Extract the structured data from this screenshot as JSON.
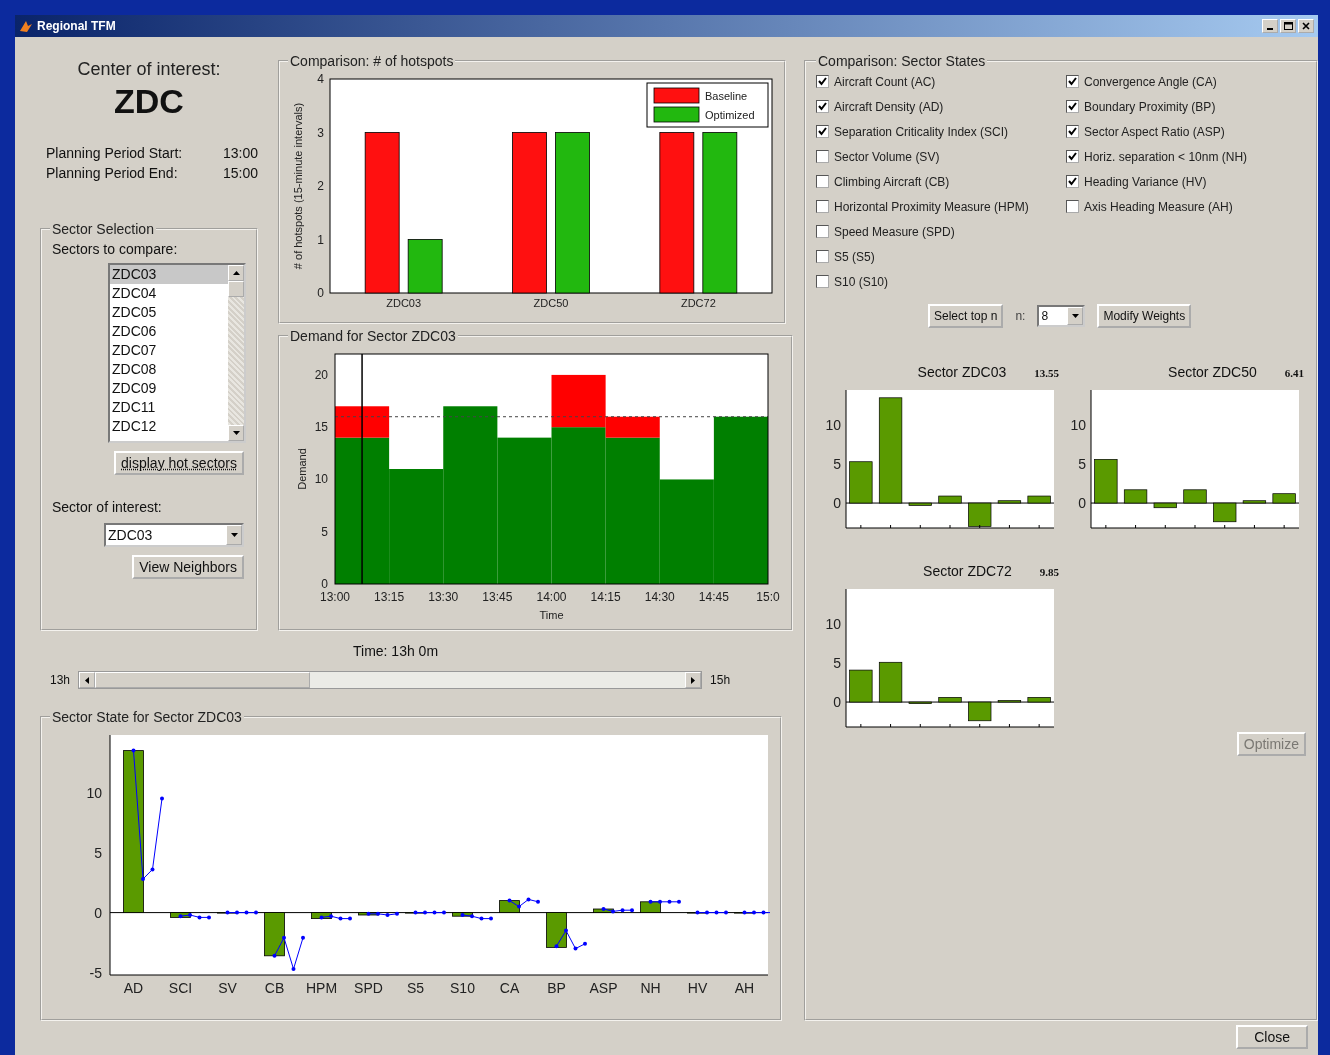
{
  "window": {
    "title": "Regional TFM"
  },
  "center": {
    "label": "Center of interest:",
    "value": "ZDC"
  },
  "planning": [
    {
      "label": "Planning Period Start:",
      "value": "13:00"
    },
    {
      "label": "Planning Period End:",
      "value": "15:00"
    }
  ],
  "sector_selection": {
    "title": "Sector Selection",
    "compare_label": "Sectors to compare:",
    "sectors": [
      {
        "label": "ZDC03",
        "selected": true
      },
      {
        "label": "ZDC04",
        "selected": false
      },
      {
        "label": "ZDC05",
        "selected": false
      },
      {
        "label": "ZDC06",
        "selected": false
      },
      {
        "label": "ZDC07",
        "selected": false
      },
      {
        "label": "ZDC08",
        "selected": false
      },
      {
        "label": "ZDC09",
        "selected": false
      },
      {
        "label": "ZDC11",
        "selected": false
      },
      {
        "label": "ZDC12",
        "selected": false
      }
    ],
    "hot_button": "display hot sectors",
    "interest_label": "Sector of interest:",
    "interest_value": "ZDC03",
    "neighbors_button": "View Neighbors"
  },
  "hotspots": {
    "title": "Comparison: # of hotspots",
    "chart_data": {
      "type": "bar",
      "ylabel": "# of hotspots (15-minute intervals)",
      "categories": [
        "ZDC03",
        "ZDC50",
        "ZDC72"
      ],
      "ylim": [
        0,
        4
      ],
      "yticks": [
        0,
        1,
        2,
        3,
        4
      ],
      "legend": true,
      "series": [
        {
          "name": "Baseline",
          "color": "#ff1010",
          "values": [
            3,
            3,
            3
          ]
        },
        {
          "name": "Optimized",
          "color": "#22b80f",
          "values": [
            1,
            3,
            3
          ]
        }
      ]
    }
  },
  "demand": {
    "title": "Demand for Sector ZDC03",
    "chart_data": {
      "type": "bar",
      "stacked": true,
      "xlabel": "Time",
      "ylabel": "Demand",
      "x": [
        13.125,
        13.375,
        13.625,
        13.875,
        14.125,
        14.375,
        14.625,
        14.875
      ],
      "xlim": [
        13,
        15
      ],
      "ylim": [
        0,
        22
      ],
      "yticks": [
        0,
        5,
        10,
        15,
        20
      ],
      "xticks": [
        {
          "value": 13,
          "label": "13:00"
        },
        {
          "value": 13.25,
          "label": "13:15"
        },
        {
          "value": 13.5,
          "label": "13:30"
        },
        {
          "value": 13.75,
          "label": "13:45"
        },
        {
          "value": 14,
          "label": "14:00"
        },
        {
          "value": 14.25,
          "label": "14:15"
        },
        {
          "value": 14.5,
          "label": "14:30"
        },
        {
          "value": 14.75,
          "label": "14:45"
        },
        {
          "value": 15,
          "label": "15:0"
        }
      ],
      "series": [
        {
          "color": "#007f00",
          "values": [
            14,
            11,
            17,
            14,
            15,
            14,
            10,
            16
          ]
        },
        {
          "color": "#ff0000",
          "values": [
            3,
            null,
            null,
            null,
            5,
            2,
            null,
            null
          ]
        }
      ],
      "ref_lines": [
        {
          "axis": "y",
          "value": 16
        },
        {
          "axis": "x",
          "value": 13.125
        }
      ]
    }
  },
  "time_slider": {
    "label": "Time: 13h 0m",
    "min_label": "13h",
    "max_label": "15h",
    "level": 0
  },
  "sector_state": {
    "title": "Sector State for Sector ZDC03",
    "chart_data": {
      "type": "bar",
      "categories": [
        "AD",
        "SCI",
        "SV",
        "CB",
        "HPM",
        "SPD",
        "S5",
        "S10",
        "CA",
        "BP",
        "ASP",
        "NH",
        "HV",
        "AH"
      ],
      "ylim": [
        -5.2,
        14.8
      ],
      "yticks": [
        -5,
        0,
        5,
        10
      ],
      "series": [
        {
          "color": "#5a9a00",
          "values": [
            13.5,
            -0.4,
            0,
            -3.6,
            -0.5,
            -0.2,
            0,
            -0.3,
            1,
            -2.9,
            0.3,
            0.9,
            0,
            0
          ]
        }
      ]
    }
  },
  "sector_states": {
    "title": "Comparison: Sector States",
    "checkboxes": [
      {
        "label": "Aircraft Count (AC)",
        "checked": true
      },
      {
        "label": "Aircraft Density (AD)",
        "checked": true
      },
      {
        "label": "Separation Criticality Index (SCI)",
        "checked": true
      },
      {
        "label": "Sector Volume (SV)",
        "checked": false
      },
      {
        "label": "Climbing Aircraft (CB)",
        "checked": false
      },
      {
        "label": "Horizontal Proximity Measure (HPM)",
        "checked": false
      },
      {
        "label": "Speed Measure (SPD)",
        "checked": false
      },
      {
        "label": "S5 (S5)",
        "checked": false
      },
      {
        "label": "S10 (S10)",
        "checked": false
      },
      {
        "label": "Convergence Angle (CA)",
        "checked": true
      },
      {
        "label": "Boundary Proximity (BP)",
        "checked": true
      },
      {
        "label": "Sector Aspect Ratio (ASP)",
        "checked": true
      },
      {
        "label": "Horiz. separation < 10nm (NH)",
        "checked": true
      },
      {
        "label": "Heading Variance (HV)",
        "checked": true
      },
      {
        "label": "Axis Heading Measure (AH)",
        "checked": false
      }
    ],
    "select_button": "Select top n",
    "n_label": "n:",
    "n_value": "8",
    "weights_button": "Modify Weights",
    "sectors": [
      {
        "title": "Sector ZDC03",
        "score": "13.55",
        "chart_data": {
          "type": "bar",
          "categories": [
            null,
            null,
            null,
            null,
            null,
            null,
            null
          ],
          "ylim": [
            -3.2,
            14.5
          ],
          "yticks": [
            0,
            5,
            10
          ],
          "series": [
            {
              "color": "#5a9a00",
              "values": [
                5.3,
                13.5,
                -0.3,
                0.9,
                -3,
                0.3,
                0.9
              ]
            }
          ]
        }
      },
      {
        "title": "Sector ZDC50",
        "score": "6.41",
        "chart_data": {
          "type": "bar",
          "categories": [
            null,
            null,
            null,
            null,
            null,
            null,
            null
          ],
          "ylim": [
            -3.2,
            14.5
          ],
          "yticks": [
            0,
            5,
            10
          ],
          "series": [
            {
              "color": "#5a9a00",
              "values": [
                5.6,
                1.7,
                -0.6,
                1.7,
                -2.4,
                0.3,
                1.2
              ]
            }
          ]
        }
      },
      {
        "title": "Sector ZDC72",
        "score": "9.85",
        "chart_data": {
          "type": "bar",
          "categories": [
            null,
            null,
            null,
            null,
            null,
            null,
            null
          ],
          "ylim": [
            -3.2,
            14.5
          ],
          "yticks": [
            0,
            5,
            10
          ],
          "series": [
            {
              "color": "#5a9a00",
              "values": [
                4.1,
                5.1,
                -0.2,
                0.6,
                -2.4,
                0.2,
                0.6
              ]
            }
          ]
        }
      }
    ]
  },
  "optimize": {
    "label": "Optimize",
    "disabled": true
  },
  "close_button": "Close"
}
